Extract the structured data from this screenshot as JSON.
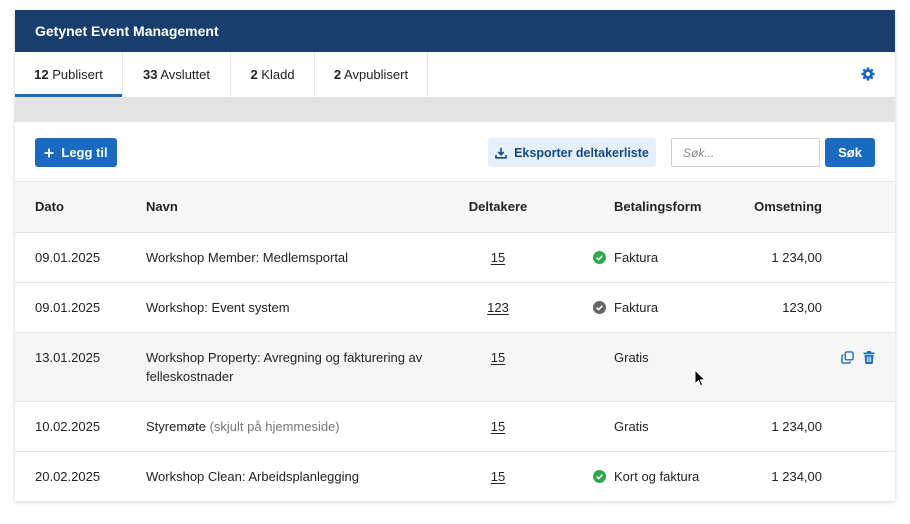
{
  "app": {
    "title": "Getynet Event Management"
  },
  "tabs": [
    {
      "count": "12",
      "label": "Publisert",
      "active": true
    },
    {
      "count": "33",
      "label": "Avsluttet",
      "active": false
    },
    {
      "count": "2",
      "label": "Kladd",
      "active": false
    },
    {
      "count": "2",
      "label": "Avpublisert",
      "active": false
    }
  ],
  "settings_icon": "gear-icon",
  "toolbar": {
    "add": {
      "label": "Legg til",
      "icon": "plus-icon"
    },
    "export": {
      "label": "Eksporter deltakerliste",
      "icon": "download-icon"
    },
    "search": {
      "value": "",
      "placeholder": "Søk...",
      "button_label": "Søk"
    }
  },
  "table": {
    "columns": {
      "date": "Dato",
      "name": "Navn",
      "participants": "Deltakere",
      "payment": "Betalingsform",
      "revenue": "Omsetning"
    },
    "row_actions": [
      {
        "icon": "copy-icon"
      },
      {
        "icon": "trash-icon"
      }
    ],
    "rows": [
      {
        "date": "09.01.2025",
        "name": "Workshop Member: Medlemsportal",
        "note": "",
        "participants": "15",
        "payment": "Faktura",
        "payment_status_icon": "green-check-icon",
        "revenue": "1 234,00",
        "hovered": false
      },
      {
        "date": "09.01.2025",
        "name": "Workshop: Event system",
        "note": "",
        "participants": "123",
        "payment": "Faktura",
        "payment_status_icon": "grey-check-icon",
        "revenue": "123,00",
        "hovered": false
      },
      {
        "date": "13.01.2025",
        "name": "Workshop Property: Avregning og fakturering av felleskostnader",
        "note": "",
        "participants": "15",
        "payment": "Gratis",
        "payment_status_icon": "",
        "revenue": "",
        "hovered": true
      },
      {
        "date": "10.02.2025",
        "name": "Styremøte",
        "note": "(skjult på hjemmeside)",
        "participants": "15",
        "payment": "Gratis",
        "payment_status_icon": "",
        "revenue": "1 234,00",
        "hovered": false
      },
      {
        "date": "20.02.2025",
        "name": "Workshop Clean: Arbeidsplanlegging",
        "note": "",
        "participants": "15",
        "payment": "Kort og faktura",
        "payment_status_icon": "green-check-icon",
        "revenue": "1 234,00",
        "hovered": false
      }
    ]
  },
  "colors": {
    "header_bg": "#183e6e",
    "accent": "#1a6ac1",
    "export_bg": "#e6f0fa",
    "export_text": "#174a85",
    "status_green": "#2fa84f",
    "status_grey": "#666666",
    "muted_text": "#777777",
    "row_hover": "#f6f6f6",
    "band": "#e3e3e3"
  }
}
